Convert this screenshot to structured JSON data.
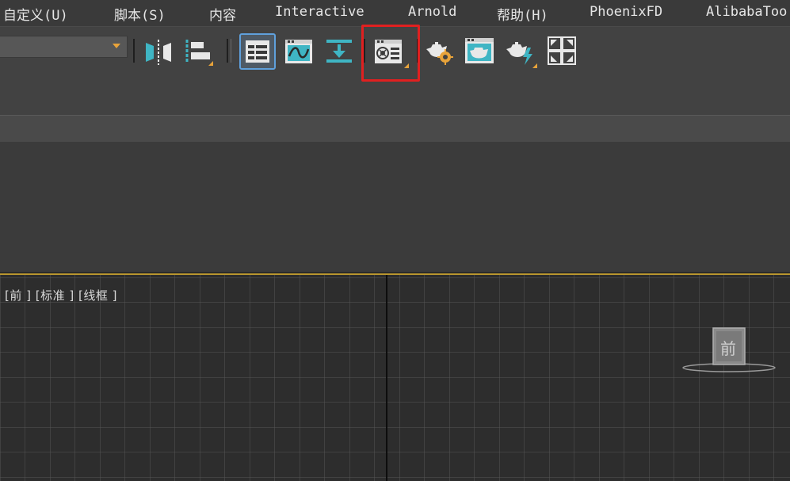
{
  "menubar": {
    "items": [
      {
        "label": "自定义(U)"
      },
      {
        "label": "脚本(S)"
      },
      {
        "label": "内容"
      },
      {
        "label": "Interactive"
      },
      {
        "label": "Arnold"
      },
      {
        "label": "帮助(H)"
      },
      {
        "label": "PhoenixFD"
      },
      {
        "label": "AlibabaToo"
      }
    ]
  },
  "toolbar": {
    "dropdown_value": "",
    "buttons": [
      {
        "icon": "mirror-icon"
      },
      {
        "icon": "align-icon"
      },
      {
        "icon": "scene-explorer-icon",
        "selected": true
      },
      {
        "icon": "curve-editor-icon"
      },
      {
        "icon": "schematic-view-icon"
      },
      {
        "icon": "render-setup-icon",
        "highlighted": true
      },
      {
        "icon": "rendered-frame-window-icon"
      },
      {
        "icon": "render-production-icon"
      },
      {
        "icon": "render-iterative-icon"
      },
      {
        "icon": "render-region-icon"
      }
    ]
  },
  "viewport": {
    "label": "[前 ] [标准 ] [线框 ]",
    "viewcube_label": "前"
  },
  "colors": {
    "accent": "#e8a33a",
    "selection": "#5fa0dc",
    "highlight": "#e02020",
    "teal": "#3fb5c4",
    "viewport_border": "#b8962e"
  }
}
